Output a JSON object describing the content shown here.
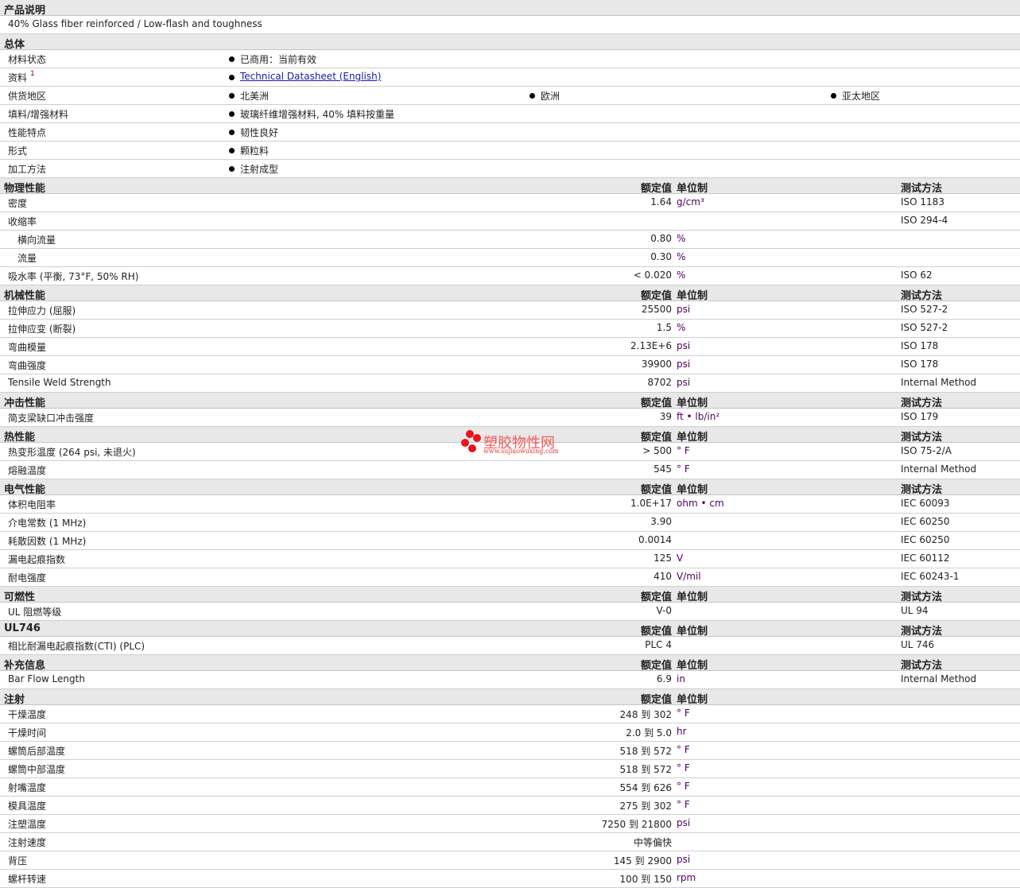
{
  "product_description": {
    "title": "产品说明",
    "text": "40% Glass fiber reinforced / Low-flash and toughness"
  },
  "general": {
    "title": "总体",
    "rows": [
      {
        "label": "材料状态",
        "items": [
          "已商用：当前有效"
        ]
      },
      {
        "label": "资料",
        "sup": "1",
        "link": "Technical Datasheet (English)"
      },
      {
        "label": "供货地区",
        "items": [
          "北美洲",
          "欧洲",
          "亚太地区"
        ]
      },
      {
        "label": "填料/增强材料",
        "items": [
          "玻璃纤维增强材料, 40% 填料按重量"
        ]
      },
      {
        "label": "性能特点",
        "items": [
          "韧性良好"
        ]
      },
      {
        "label": "形式",
        "items": [
          "颗粒料"
        ]
      },
      {
        "label": "加工方法",
        "items": [
          "注射成型"
        ]
      }
    ]
  },
  "col_headers": {
    "value": "额定值",
    "unit": "单位制",
    "method": "测试方法"
  },
  "sections": [
    {
      "title": "物理性能",
      "method_header": true,
      "rows": [
        {
          "label": "密度",
          "value": "1.64",
          "unit": "g/cm³",
          "method": "ISO 1183"
        },
        {
          "label": "收缩率",
          "value": "",
          "unit": "",
          "method": "ISO 294-4"
        },
        {
          "label": "横向流量",
          "sub": true,
          "value": "0.80",
          "unit": "%",
          "method": ""
        },
        {
          "label": "流量",
          "sub": true,
          "value": "0.30",
          "unit": "%",
          "method": ""
        },
        {
          "label": "吸水率 (平衡, 73°F, 50% RH)",
          "value": "< 0.020",
          "unit": "%",
          "method": "ISO 62"
        }
      ]
    },
    {
      "title": "机械性能",
      "method_header": true,
      "rows": [
        {
          "label": "拉伸应力 (屈服)",
          "value": "25500",
          "unit": "psi",
          "method": "ISO 527-2"
        },
        {
          "label": "拉伸应变 (断裂)",
          "value": "1.5",
          "unit": "%",
          "method": "ISO 527-2"
        },
        {
          "label": "弯曲模量",
          "value": "2.13E+6",
          "unit": "psi",
          "method": "ISO 178"
        },
        {
          "label": "弯曲强度",
          "value": "39900",
          "unit": "psi",
          "method": "ISO 178"
        },
        {
          "label": "Tensile Weld Strength",
          "value": "8702",
          "unit": "psi",
          "method": "Internal Method"
        }
      ]
    },
    {
      "title": "冲击性能",
      "method_header": true,
      "rows": [
        {
          "label": "简支梁缺口冲击强度",
          "value": "39",
          "unit": "ft • lb/in²",
          "method": "ISO 179"
        }
      ]
    },
    {
      "title": "热性能",
      "method_header": true,
      "rows": [
        {
          "label": "热变形温度 (264 psi, 未退火)",
          "value": "> 500",
          "unit": "° F",
          "method": "ISO 75-2/A"
        },
        {
          "label": "熔融温度",
          "value": "545",
          "unit": "° F",
          "method": "Internal Method"
        }
      ]
    },
    {
      "title": "电气性能",
      "method_header": true,
      "rows": [
        {
          "label": "体积电阻率",
          "value": "1.0E+17",
          "unit": "ohm • cm",
          "method": "IEC 60093"
        },
        {
          "label": "介电常数 (1 MHz)",
          "value": "3.90",
          "unit": "",
          "method": "IEC 60250"
        },
        {
          "label": "耗散因数 (1 MHz)",
          "value": "0.0014",
          "unit": "",
          "method": "IEC 60250"
        },
        {
          "label": "漏电起痕指数",
          "value": "125",
          "unit": "V",
          "method": "IEC 60112"
        },
        {
          "label": "耐电强度",
          "value": "410",
          "unit": "V/mil",
          "method": "IEC 60243-1"
        }
      ]
    },
    {
      "title": "可燃性",
      "method_header": true,
      "rows": [
        {
          "label": "UL 阻燃等级",
          "value": "V-0",
          "unit": "",
          "method": "UL 94"
        }
      ]
    },
    {
      "title": "UL746",
      "method_header": true,
      "rows": [
        {
          "label": "相比耐漏电起痕指数(CTI) (PLC)",
          "value": "PLC 4",
          "unit": "",
          "method": "UL 746"
        }
      ]
    },
    {
      "title": "补充信息",
      "method_header": true,
      "rows": [
        {
          "label": "Bar Flow Length",
          "value": "6.9",
          "unit": "in",
          "method": "Internal Method"
        }
      ]
    },
    {
      "title": "注射",
      "method_header": false,
      "rows": [
        {
          "label": "干燥温度",
          "value": "248 到  302",
          "unit": "° F",
          "method": ""
        },
        {
          "label": "干燥时间",
          "value": "2.0 到  5.0",
          "unit": "hr",
          "method": ""
        },
        {
          "label": "螺筒后部温度",
          "value": "518 到  572",
          "unit": "° F",
          "method": ""
        },
        {
          "label": "螺筒中部温度",
          "value": "518 到  572",
          "unit": "° F",
          "method": ""
        },
        {
          "label": "射嘴温度",
          "value": "554 到  626",
          "unit": "° F",
          "method": ""
        },
        {
          "label": "模具温度",
          "value": "275 到  302",
          "unit": "° F",
          "method": ""
        },
        {
          "label": "注塑温度",
          "value": "7250 到  21800",
          "unit": "psi",
          "method": ""
        },
        {
          "label": "注射速度",
          "value": "中等偏快",
          "unit": "",
          "method": ""
        },
        {
          "label": "背压",
          "value": "145 到  2900",
          "unit": "psi",
          "method": ""
        },
        {
          "label": "螺杆转速",
          "value": "100 到  150",
          "unit": "rpm",
          "method": ""
        }
      ]
    }
  ],
  "watermark": {
    "name": "塑胶物性网",
    "url": "www.sujiaowuxing.com"
  }
}
